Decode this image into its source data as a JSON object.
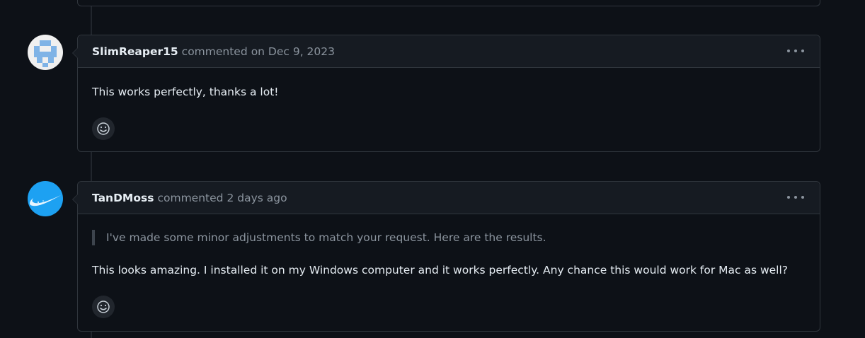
{
  "comments": [
    {
      "author": "SlimReaper15",
      "action": "commented",
      "timestamp": "on Dec 9, 2023",
      "body": "This works perfectly, thanks a lot!",
      "avatar_icon": "pixel-identicon",
      "avatar_color": "#7fb3e6"
    },
    {
      "author": "TanDMoss",
      "action": "commented",
      "timestamp": "2 days ago",
      "quote": "I've made some minor adjustments to match your request. Here are the results.",
      "body": "This looks amazing. I installed it on my Windows computer and it works perfectly. Any chance this would work for Mac as well?",
      "avatar_icon": "swoosh-logo",
      "avatar_color": "#1da1f2"
    }
  ],
  "icons": {
    "more": "kebab-horizontal-icon",
    "reaction": "smiley-icon"
  },
  "colors": {
    "background": "#0d1117",
    "header": "#161b22",
    "border": "#30363d",
    "muted": "#8b949e",
    "text": "#e6edf3"
  }
}
